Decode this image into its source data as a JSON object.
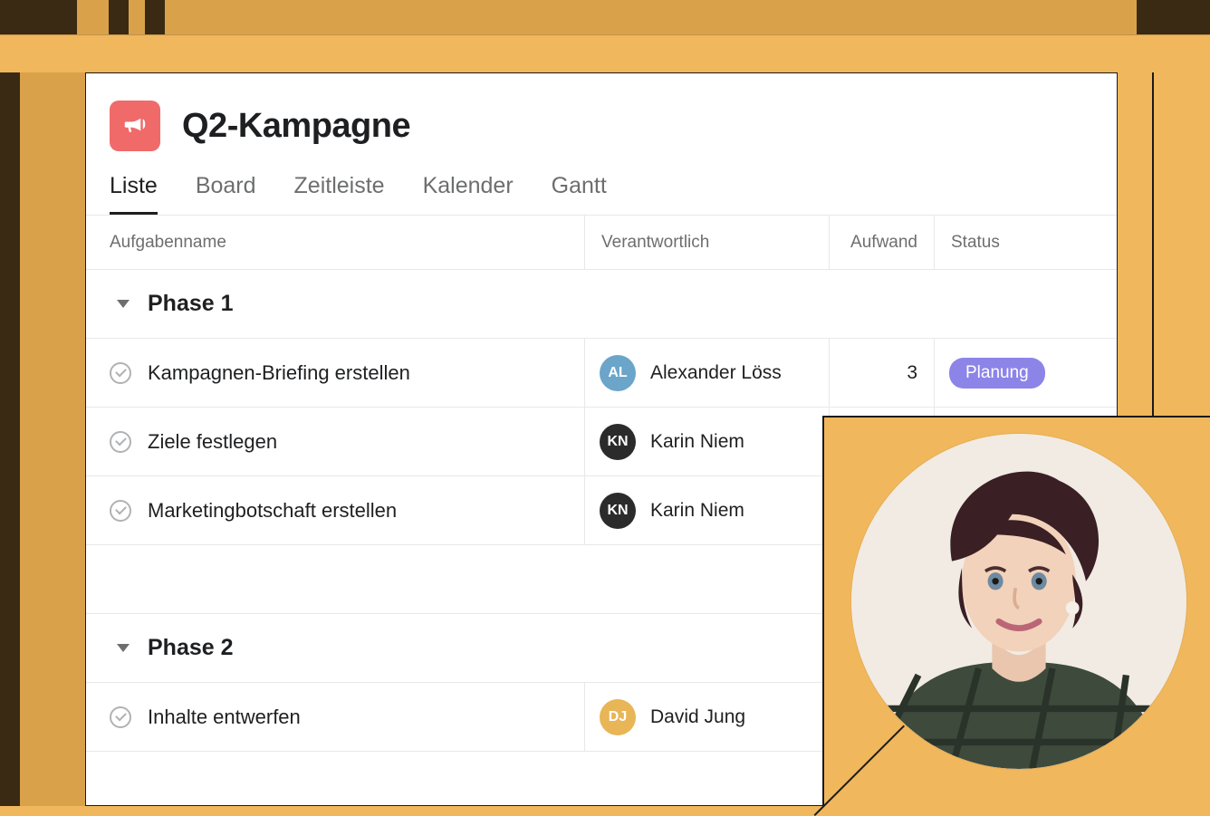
{
  "project": {
    "title": "Q2-Kampagne",
    "icon": "megaphone-icon"
  },
  "tabs": [
    {
      "label": "Liste",
      "active": true
    },
    {
      "label": "Board",
      "active": false
    },
    {
      "label": "Zeitleiste",
      "active": false
    },
    {
      "label": "Kalender",
      "active": false
    },
    {
      "label": "Gantt",
      "active": false
    }
  ],
  "columns": {
    "task": "Aufgabenname",
    "owner": "Verantwortlich",
    "effort": "Aufwand",
    "status": "Status"
  },
  "sections": [
    {
      "title": "Phase 1",
      "tasks": [
        {
          "name": "Kampagnen-Briefing erstellen",
          "owner": "Alexander Löss",
          "avatar_bg": "#6ba5c9",
          "avatar_initials": "AL",
          "effort": "3",
          "status": "Planung",
          "status_color": "#8d84e8"
        },
        {
          "name": "Ziele festlegen",
          "owner": "Karin Niem",
          "avatar_bg": "#2b2b2b",
          "avatar_initials": "KN",
          "effort": "",
          "status": "",
          "status_color": ""
        },
        {
          "name": "Marketingbotschaft erstellen",
          "owner": "Karin Niem",
          "avatar_bg": "#2b2b2b",
          "avatar_initials": "KN",
          "effort": "",
          "status": "",
          "status_color": ""
        }
      ]
    },
    {
      "title": "Phase 2",
      "tasks": [
        {
          "name": "Inhalte entwerfen",
          "owner": "David Jung",
          "avatar_bg": "#e8b557",
          "avatar_initials": "DJ",
          "effort": "",
          "status": "",
          "status_color": ""
        }
      ]
    }
  ],
  "portrait": {
    "description": "user-portrait"
  }
}
